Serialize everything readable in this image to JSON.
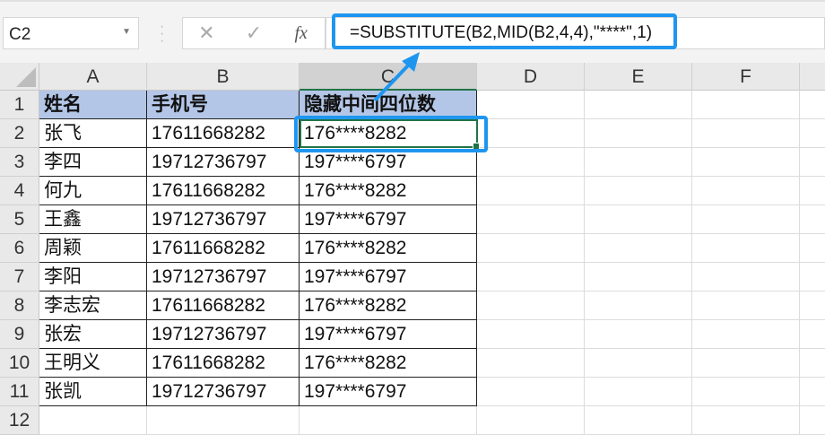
{
  "name_box": "C2",
  "formula_bar": {
    "cancel_icon": "✕",
    "enter_icon": "✓",
    "fx_label": "fx",
    "formula": "=SUBSTITUTE(B2,MID(B2,4,4),\"****\",1)"
  },
  "columns": [
    "A",
    "B",
    "C",
    "D",
    "E",
    "F"
  ],
  "row_numbers": [
    "1",
    "2",
    "3",
    "4",
    "5",
    "6",
    "7",
    "8",
    "9",
    "10",
    "11",
    "12"
  ],
  "headers": [
    "姓名",
    "手机号",
    "隐藏中间四位数"
  ],
  "rows": [
    [
      "张飞",
      "17611668282",
      "176****8282"
    ],
    [
      "李四",
      "19712736797",
      "197****6797"
    ],
    [
      "何九",
      "17611668282",
      "176****8282"
    ],
    [
      "王鑫",
      "19712736797",
      "197****6797"
    ],
    [
      "周颖",
      "17611668282",
      "176****8282"
    ],
    [
      "李阳",
      "19712736797",
      "197****6797"
    ],
    [
      "李志宏",
      "17611668282",
      "176****8282"
    ],
    [
      "张宏",
      "19712736797",
      "197****6797"
    ],
    [
      "王明义",
      "17611668282",
      "176****8282"
    ],
    [
      "张凯",
      "19712736797",
      "197****6797"
    ]
  ],
  "colors": {
    "header_fill": "#b4c6e7",
    "highlight": "#1e96f0",
    "excel_green": "#217346"
  }
}
